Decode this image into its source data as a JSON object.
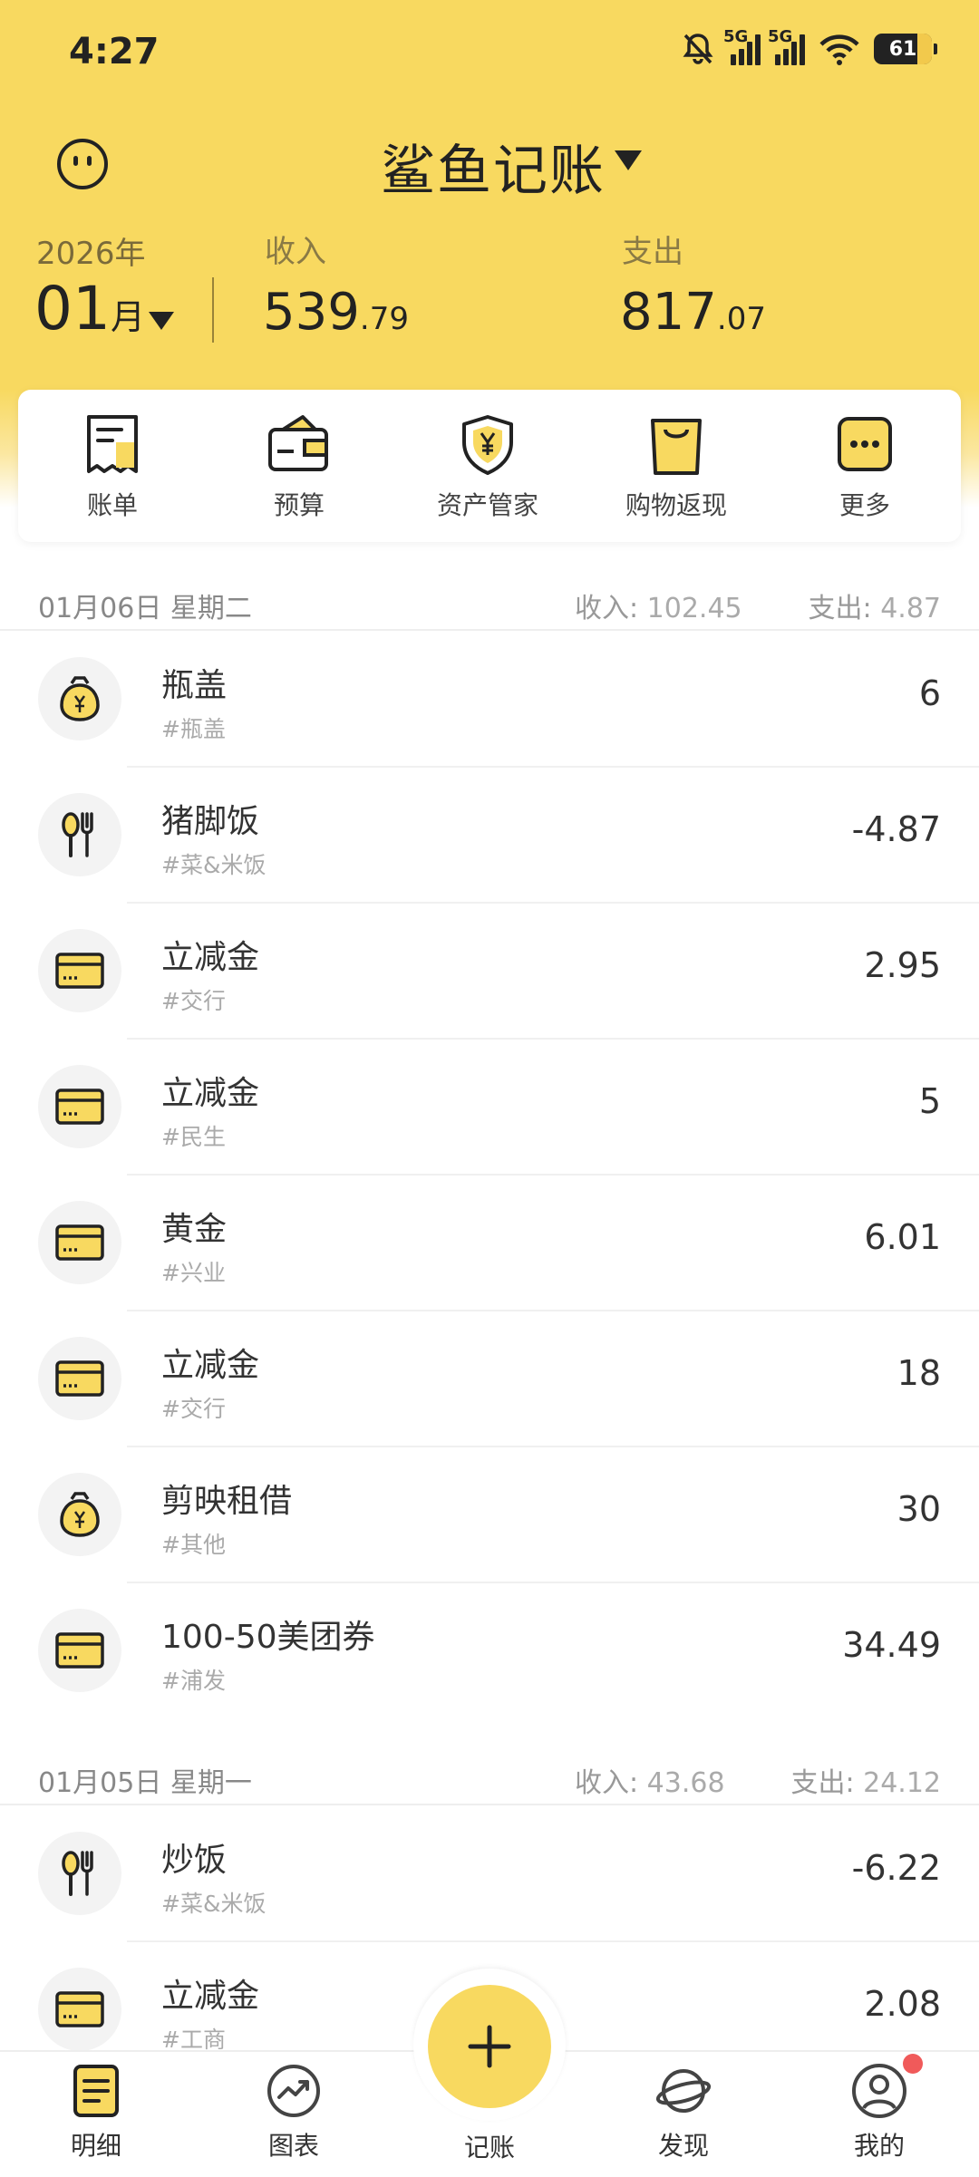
{
  "status_bar": {
    "time": "4:27",
    "battery": "61",
    "net1": "5G",
    "net2": "5G"
  },
  "header": {
    "title": "鲨鱼记账",
    "year": "2026年",
    "month": "01",
    "month_unit": "月",
    "income_label": "收入",
    "income_int": "539",
    "income_dec": ".79",
    "expense_label": "支出",
    "expense_int": "817",
    "expense_dec": ".07"
  },
  "quick_menu": [
    {
      "label": "账单",
      "icon": "bill-icon"
    },
    {
      "label": "预算",
      "icon": "wallet-icon"
    },
    {
      "label": "资产管家",
      "icon": "shield-yen-icon"
    },
    {
      "label": "购物返现",
      "icon": "shopping-bag-icon"
    },
    {
      "label": "更多",
      "icon": "more-icon"
    }
  ],
  "days": [
    {
      "date": "01月06日 星期二",
      "income_label": "收入:",
      "income": "102.45",
      "expense_label": "支出:",
      "expense": "4.87",
      "items": [
        {
          "name": "瓶盖",
          "tag": "#瓶盖",
          "amount": "6",
          "icon": "money-bag-icon"
        },
        {
          "name": "猪脚饭",
          "tag": "#菜&米饭",
          "amount": "-4.87",
          "icon": "utensils-icon"
        },
        {
          "name": "立减金",
          "tag": "#交行",
          "amount": "2.95",
          "icon": "card-icon"
        },
        {
          "name": "立减金",
          "tag": "#民生",
          "amount": "5",
          "icon": "card-icon"
        },
        {
          "name": "黄金",
          "tag": "#兴业",
          "amount": "6.01",
          "icon": "card-icon"
        },
        {
          "name": "立减金",
          "tag": "#交行",
          "amount": "18",
          "icon": "card-icon"
        },
        {
          "name": "剪映租借",
          "tag": "#其他",
          "amount": "30",
          "icon": "money-bag-icon"
        },
        {
          "name": "100-50美团券",
          "tag": "#浦发",
          "amount": "34.49",
          "icon": "card-icon"
        }
      ]
    },
    {
      "date": "01月05日 星期一",
      "income_label": "收入:",
      "income": "43.68",
      "expense_label": "支出:",
      "expense": "24.12",
      "items": [
        {
          "name": "炒饭",
          "tag": "#菜&米饭",
          "amount": "-6.22",
          "icon": "utensils-icon"
        },
        {
          "name": "立减金",
          "tag": "#工商",
          "amount": "2.08",
          "icon": "card-icon"
        }
      ]
    }
  ],
  "bottom_nav": [
    {
      "label": "明细",
      "icon": "detail-icon"
    },
    {
      "label": "图表",
      "icon": "chart-icon"
    },
    {
      "label": "记账",
      "icon": "plus-icon"
    },
    {
      "label": "发现",
      "icon": "planet-icon"
    },
    {
      "label": "我的",
      "icon": "profile-icon"
    }
  ],
  "colors": {
    "accent": "#f8d960",
    "badge": "#f05a5a"
  }
}
